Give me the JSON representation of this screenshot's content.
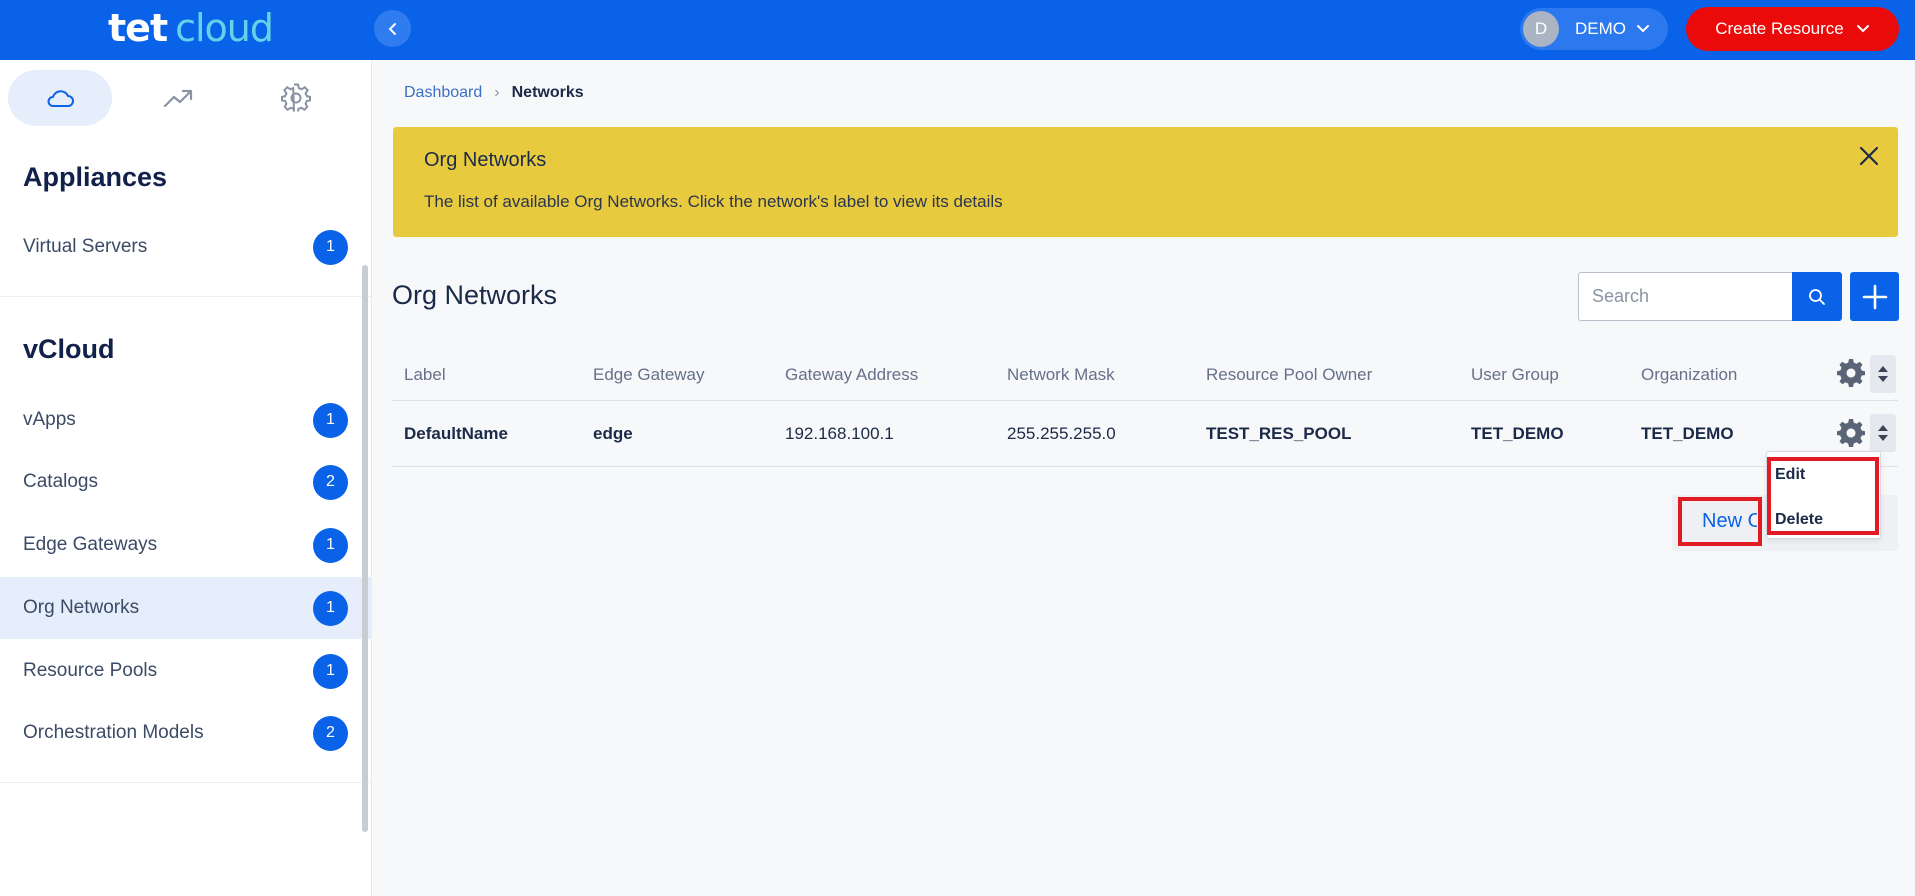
{
  "header": {
    "logo_primary": "tet",
    "logo_secondary": "cloud",
    "user_initial": "D",
    "user_name": "DEMO",
    "create_label": "Create Resource",
    "brand_color": "#0a62e8",
    "create_color": "#ea0a0a"
  },
  "sidebar": {
    "tabs": [
      {
        "icon": "cloud-icon",
        "active": true
      },
      {
        "icon": "trend-icon",
        "active": false
      },
      {
        "icon": "gear-icon",
        "active": false
      }
    ],
    "sections": [
      {
        "title": "Appliances",
        "items": [
          {
            "label": "Virtual Servers",
            "count": "1"
          }
        ]
      },
      {
        "title": "vCloud",
        "items": [
          {
            "label": "vApps",
            "count": "1"
          },
          {
            "label": "Catalogs",
            "count": "2"
          },
          {
            "label": "Edge Gateways",
            "count": "1"
          },
          {
            "label": "Org Networks",
            "count": "1",
            "active": true
          },
          {
            "label": "Resource Pools",
            "count": "1"
          },
          {
            "label": "Orchestration Models",
            "count": "2"
          }
        ]
      }
    ]
  },
  "breadcrumb": {
    "parent": "Dashboard",
    "separator": "›",
    "current": "Networks"
  },
  "alert": {
    "title": "Org Networks",
    "text": "The list of available Org Networks. Click the network's label to view its details",
    "color": "#e8ca3e"
  },
  "main": {
    "title": "Org Networks",
    "search_placeholder": "Search",
    "columns": [
      "Label",
      "Edge Gateway",
      "Gateway Address",
      "Network Mask",
      "Resource Pool Owner",
      "User Group",
      "Organization"
    ],
    "rows": [
      [
        "DefaultName",
        "edge",
        "192.168.100.1",
        "255.255.255.0",
        "TEST_RES_POOL",
        "TET_DEMO",
        "TET_DEMO"
      ]
    ],
    "new_label": "New Org Network"
  },
  "row_menu": {
    "items": [
      "Edit",
      "Delete"
    ]
  }
}
